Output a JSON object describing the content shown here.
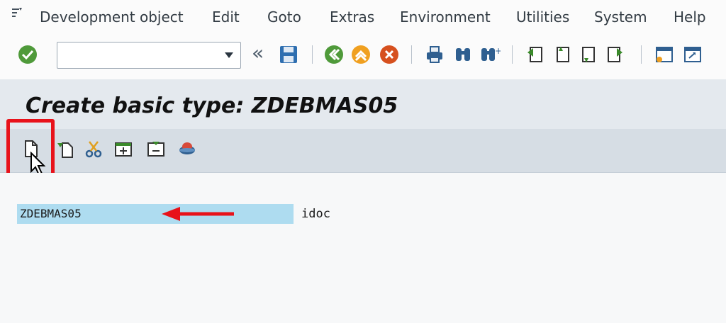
{
  "menubar": {
    "items": [
      {
        "label": "Development object"
      },
      {
        "label": "Edit"
      },
      {
        "label": "Goto"
      },
      {
        "label": "Extras"
      },
      {
        "label": "Environment"
      },
      {
        "label": "Utilities"
      },
      {
        "label": "System"
      },
      {
        "label": "Help"
      }
    ]
  },
  "toolbar": {
    "command_value": "",
    "icons": [
      "checkmark-icon",
      "save-icon",
      "back-icon",
      "exit-icon",
      "cancel-icon",
      "print-icon",
      "find-icon",
      "find-next-icon",
      "first-page-icon",
      "previous-page-icon",
      "next-page-icon",
      "last-page-icon",
      "new-session-icon",
      "shortcut-icon"
    ]
  },
  "title": "Create basic type: ZDEBMAS05",
  "app_toolbar": {
    "icons": [
      "create-segment-icon",
      "insert-segment-icon",
      "cut-icon",
      "expand-icon",
      "collapse-icon",
      "segment-editor-icon"
    ]
  },
  "work": {
    "basic_type_name": "ZDEBMAS05",
    "description": "idoc"
  },
  "colors": {
    "title_band": "#e4e9ee",
    "app_toolbar": "#d6dde4",
    "field_highlight": "#aedcf0",
    "annotation_red": "#e8121a"
  }
}
